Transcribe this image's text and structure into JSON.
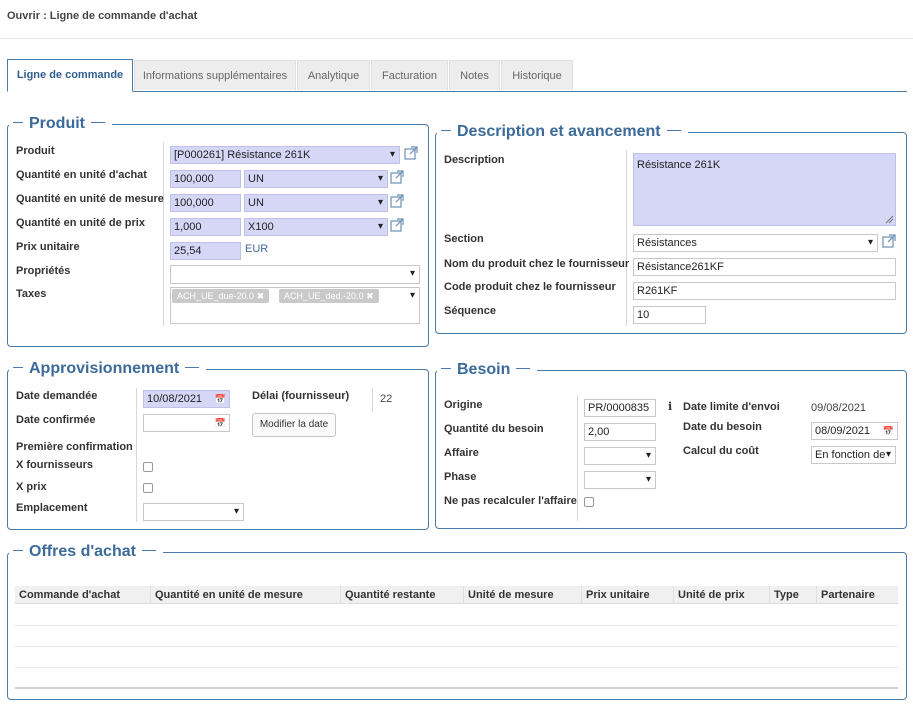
{
  "header": {
    "title": "Ouvrir : Ligne de commande d'achat"
  },
  "tabs": [
    {
      "label": "Ligne de commande",
      "active": true
    },
    {
      "label": "Informations supplémentaires"
    },
    {
      "label": "Analytique"
    },
    {
      "label": "Facturation"
    },
    {
      "label": "Notes"
    },
    {
      "label": "Historique"
    }
  ],
  "produit": {
    "legend": "Produit",
    "product_label": "Produit",
    "product_value": "[P000261] Résistance 261K",
    "qty_purchase_label": "Quantité en unité d'achat",
    "qty_purchase_value": "100,000",
    "qty_purchase_unit": "UN",
    "qty_measure_label": "Quantité en unité de mesure",
    "qty_measure_value": "100,000",
    "qty_measure_unit": "UN",
    "qty_price_label": "Quantité en unité de prix",
    "qty_price_value": "1,000",
    "qty_price_unit": "X100",
    "unit_price_label": "Prix unitaire",
    "unit_price_value": "25,54",
    "currency": "EUR",
    "properties_label": "Propriétés",
    "taxes_label": "Taxes",
    "taxes": [
      "ACH_UE_due-20.0",
      "ACH_UE_ded.-20.0"
    ]
  },
  "description": {
    "legend": "Description et avancement",
    "description_label": "Description",
    "description_value": "Résistance 261K",
    "section_label": "Section",
    "section_value": "Résistances",
    "supplier_name_label": "Nom du produit chez le fournisseur",
    "supplier_name_value": "Résistance261KF",
    "supplier_code_label": "Code produit chez le fournisseur",
    "supplier_code_value": "R261KF",
    "sequence_label": "Séquence",
    "sequence_value": "10"
  },
  "appro": {
    "legend": "Approvisionnement",
    "date_requested_label": "Date demandée",
    "date_requested_value": "10/08/2021",
    "delay_label": "Délai (fournisseur)",
    "delay_value": "22",
    "date_confirmed_label": "Date confirmée",
    "modify_button": "Modifier la date",
    "first_confirmation_label": "Première confirmation",
    "x_suppliers_label": "X fournisseurs",
    "x_price_label": "X prix",
    "location_label": "Emplacement"
  },
  "besoin": {
    "legend": "Besoin",
    "origin_label": "Origine",
    "origin_value": "PR/0000835",
    "need_qty_label": "Quantité du besoin",
    "need_qty_value": "2,00",
    "affair_label": "Affaire",
    "phase_label": "Phase",
    "no_recalc_label": "Ne pas recalculer l'affaire",
    "info_icon_text": "i",
    "send_deadline_label": "Date limite d'envoi",
    "send_deadline_value": "09/08/2021",
    "need_date_label": "Date du besoin",
    "need_date_value": "08/09/2021",
    "cost_calc_label": "Calcul du coût",
    "cost_calc_value": "En fonction de"
  },
  "offres": {
    "legend": "Offres d'achat",
    "columns": [
      "Commande d'achat",
      "Quantité en unité de mesure",
      "Quantité restante",
      "Unité de mesure",
      "Prix unitaire",
      "Unité de prix",
      "Type",
      "Partenaire"
    ]
  },
  "colors": {
    "accent": "#4a7aac",
    "required_bg": "#d6d6f6",
    "link": "#3c6b9a"
  }
}
